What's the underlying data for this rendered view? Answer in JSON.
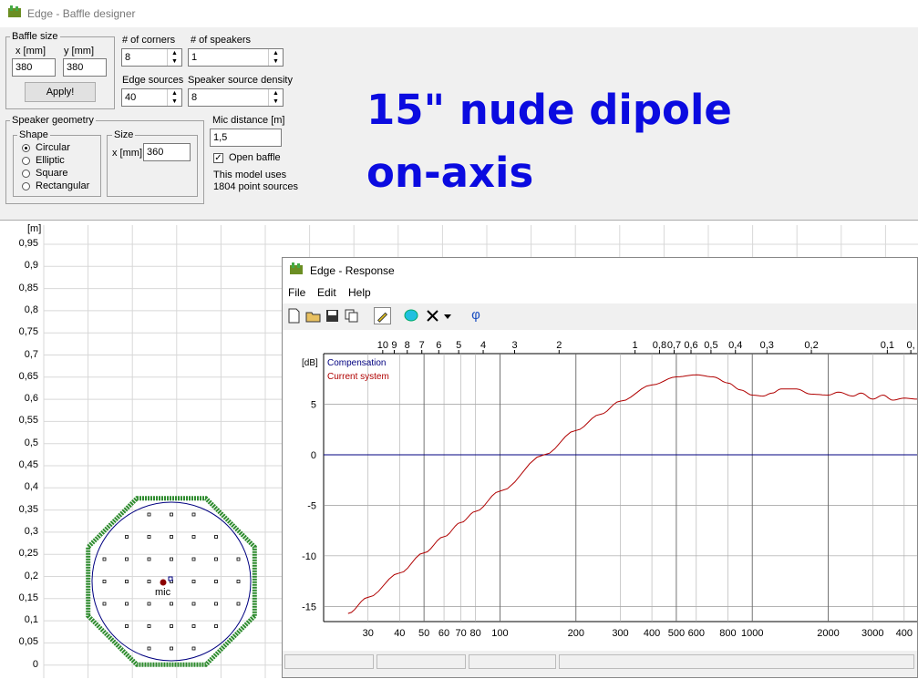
{
  "window": {
    "title": "Edge - Baffle designer"
  },
  "baffle_size": {
    "group_label": "Baffle size",
    "x_label": "x [mm]",
    "y_label": "y [mm]",
    "x_value": "380",
    "y_value": "380",
    "apply_label": "Apply!"
  },
  "corners": {
    "label": "# of corners",
    "value": "8"
  },
  "speakers": {
    "label": "# of speakers",
    "value": "1"
  },
  "edge_sources": {
    "label": "Edge sources",
    "value": "40"
  },
  "source_density": {
    "label": "Speaker source density",
    "value": "8"
  },
  "speaker_geometry": {
    "group_label": "Speaker geometry",
    "shape_label": "Shape",
    "shapes": [
      "Circular",
      "Elliptic",
      "Square",
      "Rectangular"
    ],
    "selected": "Circular",
    "size_label": "Size",
    "size_x_label": "x [mm]",
    "size_x_value": "360"
  },
  "mic": {
    "label": "Mic distance [m]",
    "value": "1,5",
    "open_baffle_label": "Open baffle",
    "open_baffle_checked": true,
    "info_line1": "This model uses",
    "info_line2": "1804 point sources"
  },
  "overlay": {
    "line1": "15\" nude dipole",
    "line2": "on-axis"
  },
  "baffle_plot": {
    "unit": "[m]",
    "yticks": [
      "0,95",
      "0,9",
      "0,85",
      "0,8",
      "0,75",
      "0,7",
      "0,65",
      "0,6",
      "0,55",
      "0,5",
      "0,45",
      "0,4",
      "0,35",
      "0,3",
      "0,25",
      "0,2",
      "0,15",
      "0,1",
      "0,05",
      "0"
    ],
    "mic_label": "mic",
    "colors": {
      "baffle": "#2e8b2e",
      "speaker": "#000080",
      "mic": "#8b0000"
    }
  },
  "response": {
    "title": "Edge - Response",
    "menu": [
      "File",
      "Edit",
      "Help"
    ],
    "toolbar_icons": [
      "new-icon",
      "open-icon",
      "save-icon",
      "copy-icon",
      "pen-icon",
      "layers-icon",
      "delete-icon",
      "dropdown-icon",
      "phase-icon"
    ],
    "phase_symbol": "φ",
    "unit": "[dB]",
    "legend": [
      {
        "name": "Compensation",
        "color": "#000080"
      },
      {
        "name": "Current system",
        "color": "#b00000"
      }
    ],
    "y_tick_labels": [
      "5",
      "0",
      "-5",
      "-10",
      "-15"
    ],
    "x_tick_labels": [
      "30",
      "40",
      "50",
      "60",
      "70",
      "80",
      "100",
      "200",
      "300",
      "400",
      "500",
      "600",
      "800",
      "1000",
      "2000",
      "3000",
      "400"
    ],
    "top_tick_labels": [
      "10",
      "9",
      "8",
      "7",
      "6",
      "5",
      "4",
      "3",
      "2",
      "1",
      "0,8",
      "0,7",
      "0,6",
      "0,5",
      "0,4",
      "0,3",
      "0,2",
      "0,1",
      "0,"
    ]
  },
  "chart_data": {
    "type": "line",
    "xscale": "log",
    "xlabel": "",
    "ylabel": "[dB]",
    "xlim": [
      20,
      4500
    ],
    "ylim": [
      -16.5,
      10
    ],
    "series": [
      {
        "name": "Compensation",
        "x": [
          20,
          4500
        ],
        "y": [
          0,
          0
        ]
      },
      {
        "name": "Current system",
        "x": [
          25,
          30,
          40,
          50,
          60,
          70,
          80,
          100,
          150,
          200,
          250,
          300,
          400,
          500,
          600,
          700,
          800,
          900,
          1000,
          1100,
          1200,
          1300,
          1500,
          1700,
          2000,
          2200,
          2500,
          2700,
          3000,
          3300,
          3600,
          4000,
          4500
        ],
        "y": [
          -15.7,
          -14.1,
          -11.7,
          -9.7,
          -8.1,
          -6.7,
          -5.6,
          -3.6,
          0.0,
          2.4,
          4.0,
          5.3,
          6.9,
          7.7,
          7.9,
          7.7,
          7.1,
          6.4,
          5.9,
          5.8,
          6.1,
          6.5,
          6.5,
          6.0,
          5.9,
          6.2,
          5.8,
          6.1,
          5.5,
          5.9,
          5.4,
          5.6,
          5.5
        ]
      }
    ]
  }
}
